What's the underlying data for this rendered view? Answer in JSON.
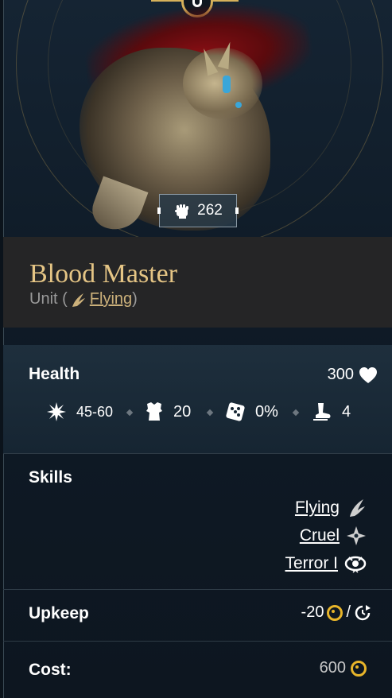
{
  "unit": {
    "name": "Blood Master",
    "type_prefix": "Unit (",
    "type_link": "Flying",
    "type_suffix": ")",
    "power": "262"
  },
  "health": {
    "label": "Health",
    "value": "300"
  },
  "stats": {
    "damage": "45-60",
    "armor": "20",
    "accuracy": "0%",
    "movement": "4"
  },
  "skills": {
    "label": "Skills",
    "items": [
      {
        "name": "Flying",
        "icon": "wing-icon"
      },
      {
        "name": "Cruel",
        "icon": "shuriken-icon"
      },
      {
        "name": "Terror I",
        "icon": "eye-icon"
      }
    ]
  },
  "upkeep": {
    "label": "Upkeep",
    "value": "-20",
    "separator": "/"
  },
  "cost": {
    "label": "Cost:",
    "value": "600"
  },
  "colors": {
    "gold": "#e5c585",
    "coin": "#e8b52a",
    "panel": "#252526"
  }
}
